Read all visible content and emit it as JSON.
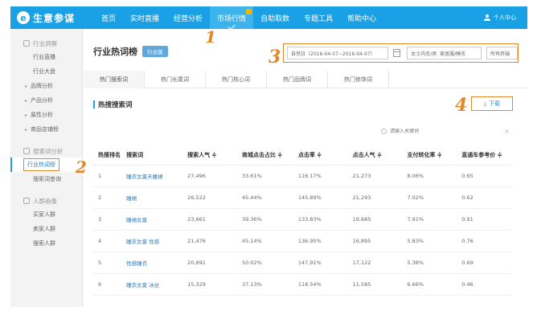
{
  "brand": {
    "logo_glyph": "e",
    "name": "生意参谋"
  },
  "nav": {
    "items": [
      "首页",
      "实时直播",
      "经营分析",
      "市场行情",
      "自助取数",
      "专题工具",
      "帮助中心"
    ],
    "active_index": 3,
    "user": "个人中心"
  },
  "sidebar": {
    "group1": "行业洞察",
    "group1_items": [
      "行业直播",
      "行业大盘"
    ],
    "group1_subs": [
      "品牌分析",
      "产品分析",
      "属性分析",
      "商品店铺榜"
    ],
    "group2": "搜索词分析",
    "group2_active": "行业热词榜",
    "group2_items": [
      "搜索词查询"
    ],
    "group3": "人群画像",
    "group3_items": [
      "买家人群",
      "卖家人群",
      "搜索人群"
    ]
  },
  "main": {
    "title": "行业热词榜",
    "tag": "行业版",
    "date_range": "自然日（2016-04-07~2016-04-07）",
    "category": "女士内衣/男",
    "category2": "家居服/睡衣",
    "terminal": "所有终端",
    "tabs": [
      "热门搜索词",
      "热门长尾词",
      "热门核心词",
      "热门品牌词",
      "热门修饰词"
    ],
    "section_title": "热搜搜索词",
    "download": "下载",
    "search_placeholder": "请输入关键词"
  },
  "table": {
    "headers": [
      "热搜排名",
      "搜索词",
      "搜索人气 ≑",
      "商城点击占比 ≑",
      "点击率 ≑",
      "点击人气 ≑",
      "支付转化率 ≑",
      "直通车参考价 ≑"
    ],
    "rows": [
      [
        "1",
        "睡衣女夏天睡裙",
        "27,496",
        "33.61%",
        "116.17%",
        "21,273",
        "8.06%",
        "0.65"
      ],
      [
        "2",
        "睡裙",
        "26,522",
        "45.44%",
        "145.89%",
        "21,293",
        "7.02%",
        "0.62"
      ],
      [
        "3",
        "睡裙女夏",
        "23,661",
        "39.36%",
        "133.83%",
        "19,685",
        "7.91%",
        "0.91"
      ],
      [
        "4",
        "睡衣女夏 性感",
        "21,476",
        "45.14%",
        "136.95%",
        "16,895",
        "5.83%",
        "0.76"
      ],
      [
        "5",
        "性感睡衣",
        "20,891",
        "50.02%",
        "147.91%",
        "17,122",
        "5.38%",
        "0.69"
      ],
      [
        "6",
        "睡衣女夏 冰丝",
        "15,329",
        "37.13%",
        "118.54%",
        "11,585",
        "6.66%",
        "0.46"
      ]
    ]
  },
  "annotations": [
    "1",
    "2",
    "3",
    "4"
  ],
  "colors": {
    "primary": "#1aa0e5",
    "annotation": "#e0872b",
    "link": "#2e7fbf"
  }
}
